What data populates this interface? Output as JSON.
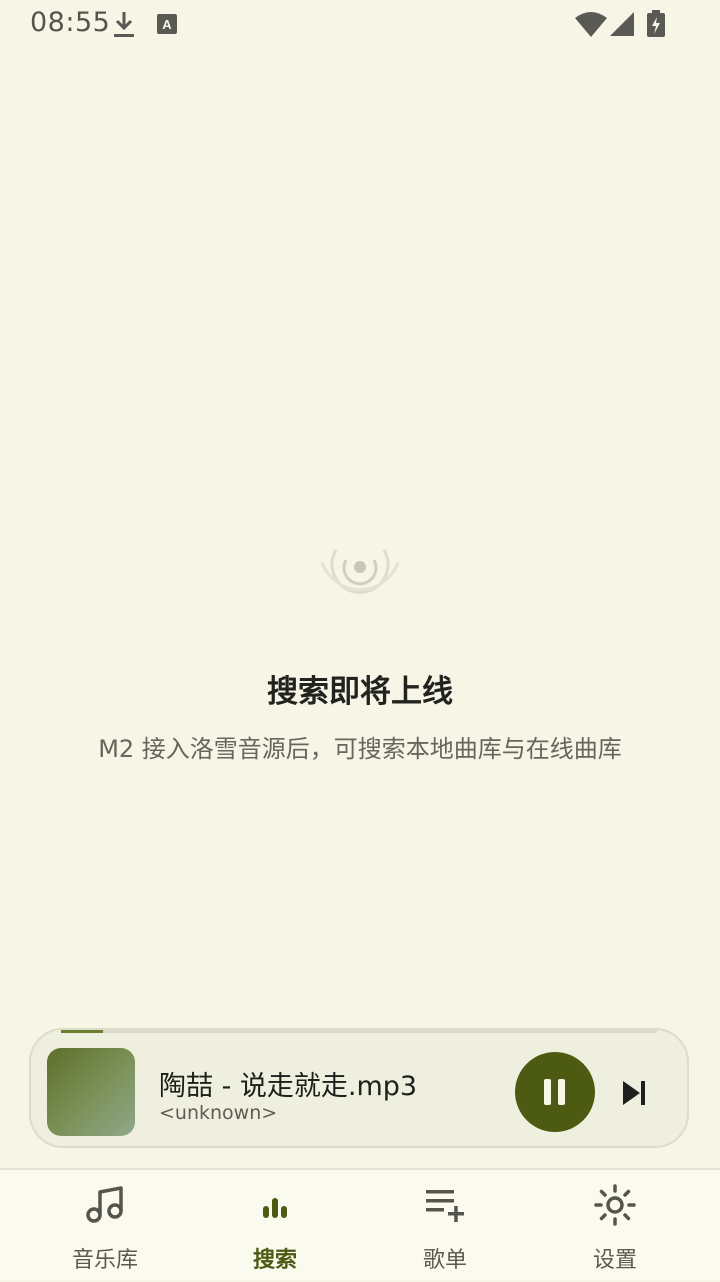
{
  "status_bar": {
    "time": "08:55",
    "icons": [
      "download-icon",
      "keyboard-a-icon",
      "wifi-icon",
      "signal-icon",
      "battery-charging-icon"
    ]
  },
  "empty_state": {
    "icon": "radar-icon",
    "title": "搜索即将上线",
    "subtitle": "M2 接入洛雪音源后，可搜索本地曲库与在线曲库"
  },
  "mini_player": {
    "title": "陶喆 - 说走就走.mp3",
    "artist": "<unknown>",
    "progress": 0.07,
    "state": "playing"
  },
  "bottom_nav": {
    "items": [
      {
        "label": "音乐库",
        "icon": "music-note-icon",
        "active": false
      },
      {
        "label": "搜索",
        "icon": "equalizer-icon",
        "active": true
      },
      {
        "label": "歌单",
        "icon": "playlist-add-icon",
        "active": false
      },
      {
        "label": "设置",
        "icon": "settings-sun-icon",
        "active": false
      }
    ]
  },
  "colors": {
    "background": "#f6f5e6",
    "accent": "#4d5a12",
    "nav_background": "#fbfaee"
  }
}
